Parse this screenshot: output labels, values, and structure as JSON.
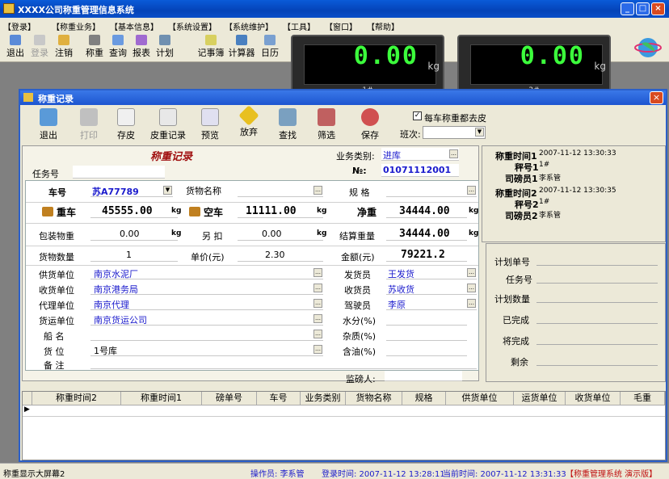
{
  "app": {
    "title": "XXXX公司称重管理信息系统"
  },
  "menu": [
    "【登录】",
    "【称重业务】",
    "【基本信息】",
    "【系统设置】",
    "【系统维护】",
    "【工具】",
    "【窗口】",
    "【帮助】"
  ],
  "toolbar": {
    "logout": "退出",
    "login": "登录",
    "logoff": "注销",
    "weigh": "称重",
    "query": "查询",
    "report": "报表",
    "plan": "计划",
    "notepad": "记事簿",
    "calculator": "计算器",
    "calendar": "日历"
  },
  "led1": {
    "value": "0.00",
    "unit": "kg",
    "index": "1#"
  },
  "led2": {
    "value": "0.00",
    "unit": "kg",
    "index": "2#"
  },
  "child": {
    "title": "称重记录"
  },
  "ctool": {
    "exit": "退出",
    "print": "打印",
    "save_draft": "存皮",
    "tare_record": "皮重记录",
    "preview": "预览",
    "abandon": "放弃",
    "find": "查找",
    "filter": "筛选",
    "save": "保存",
    "check_label": "每车称重都去皮",
    "shift_label": "班次:"
  },
  "form": {
    "title": "称重记录",
    "biz_label": "业务类别:",
    "biz_value": "进库",
    "task_label": "任务号",
    "no_label": "№:",
    "no_value": "01071112001",
    "plate_label": "车号",
    "plate_value": "苏A77789",
    "goods_label": "货物名称",
    "spec_label": "规  格",
    "gross_label": "重车",
    "gross_value": "45555.00",
    "kg": "kg",
    "empty_label": "空车",
    "empty_value": "11111.00",
    "net_label": "净重",
    "net_value": "34444.00",
    "pack_label": "包装物重",
    "pack_value": "0.00",
    "deduct_label": "另  扣",
    "deduct_value": "0.00",
    "settle_label": "结算重量",
    "settle_value": "34444.00",
    "qty_label": "货物数量",
    "qty_value": "1",
    "price_label": "单价(元)",
    "price_value": "2.30",
    "amount_label": "金额(元)",
    "amount_value": "79221.2",
    "supplier_label": "供货单位",
    "supplier_value": "南京水泥厂",
    "sender_label": "发货员",
    "sender_value": "王发货",
    "receiver_unit_label": "收货单位",
    "receiver_unit_value": "南京港务局",
    "receiver_label": "收货员",
    "receiver_value": "苏收货",
    "agent_label": "代理单位",
    "agent_value": "南京代理",
    "driver_label": "驾驶员",
    "driver_value": "李原",
    "carrier_label": "货运单位",
    "carrier_value": "南京货运公司",
    "water_label": "水分(%)",
    "ship_label": "船  名",
    "impurity_label": "杂质(%)",
    "location_label": "货  位",
    "location_value": "1号库",
    "oil_label": "含油(%)",
    "remark_label": "备  注",
    "supervisor_label": "监磅人:"
  },
  "side1": {
    "time1_label": "称重时间1",
    "time1_value": "2007-11-12 13:30:33",
    "scale1_label": "秤号1",
    "scale1_value": "1#",
    "op1_label": "司磅员1",
    "op1_value": "李系管",
    "time2_label": "称重时间2",
    "time2_value": "2007-11-12 13:30:35",
    "scale2_label": "秤号2",
    "scale2_value": "1#",
    "op2_label": "司磅员2",
    "op2_value": "李系管"
  },
  "side2": {
    "plan_no": "计划单号",
    "task_no": "任务号",
    "plan_qty": "计划数量",
    "done": "已完成",
    "todo": "将完成",
    "remain": "剩余"
  },
  "table": {
    "columns": [
      "称重时间2",
      "称重时间1",
      "磅单号",
      "车号",
      "业务类别",
      "货物名称",
      "规格",
      "供货单位",
      "运货单位",
      "收货单位",
      "毛重"
    ]
  },
  "status": {
    "screen": "称重显示大屏幕2",
    "operator": "操作员: 李系管",
    "login_time": "登录时间: 2007-11-12 13:28:11",
    "current_time": "当前时间: 2007-11-12 13:31:33",
    "system": "【称重管理系统 演示版】"
  }
}
